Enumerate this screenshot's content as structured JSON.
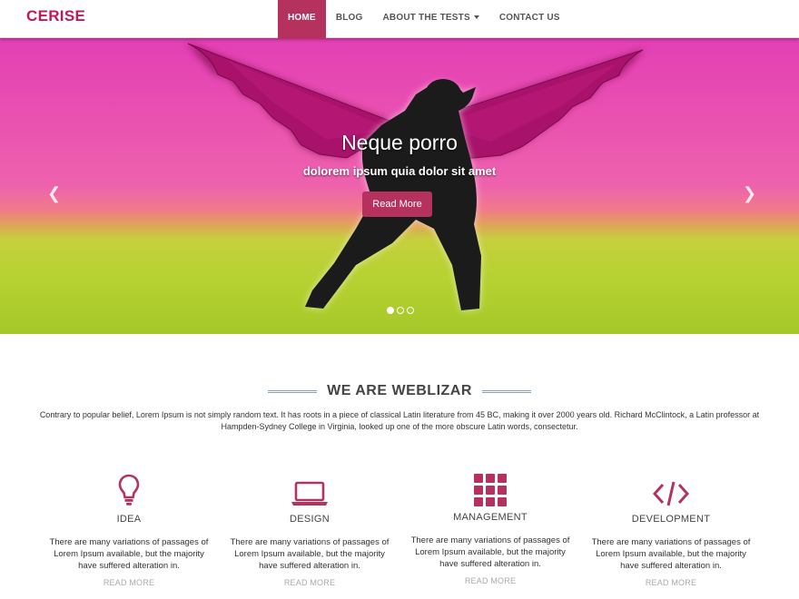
{
  "brand": "CERISE",
  "nav": [
    {
      "label": "HOME"
    },
    {
      "label": "BLOG"
    },
    {
      "label": "ABOUT THE TESTS"
    },
    {
      "label": "CONTACT US"
    }
  ],
  "hero": {
    "title": "Neque porro",
    "subtitle": "dolorem ipsum quia dolor sit amet",
    "button": "Read More",
    "prev_icon": "chevron-left-icon",
    "next_icon": "chevron-right-icon",
    "slide_count": 3,
    "active_slide": 1
  },
  "about": {
    "title": "WE ARE WEBLIZAR",
    "text": "Contrary to popular belief, Lorem Ipsum is not simply random text. It has roots in a piece of classical Latin literature from 45 BC, making it over 2000 years old. Richard McClintock, a Latin professor at Hampden-Sydney College in Virginia, looked up one of the more obscure Latin words, consectetur."
  },
  "features": [
    {
      "icon": "lightbulb-icon",
      "title": "IDEA",
      "text": "There are many variations of passages of Lorem Ipsum available, but the majority have suffered alteration in.",
      "link": "READ MORE"
    },
    {
      "icon": "laptop-icon",
      "title": "DESIGN",
      "text": "There are many variations of passages of Lorem Ipsum available, but the majority have suffered alteration in.",
      "link": "READ MORE"
    },
    {
      "icon": "grid-icon",
      "title": "MANAGEMENT",
      "text": "There are many variations of passages of Lorem Ipsum available, but the majority have suffered alteration in.",
      "link": "READ MORE"
    },
    {
      "icon": "code-icon",
      "title": "DEVELOPMENT",
      "text": "There are many variations of passages of Lorem Ipsum available, but the majority have suffered alteration in.",
      "link": "READ MORE"
    }
  ],
  "colors": {
    "accent": "#b5325f",
    "brand": "#c2185b",
    "icon": "#b5325f"
  }
}
